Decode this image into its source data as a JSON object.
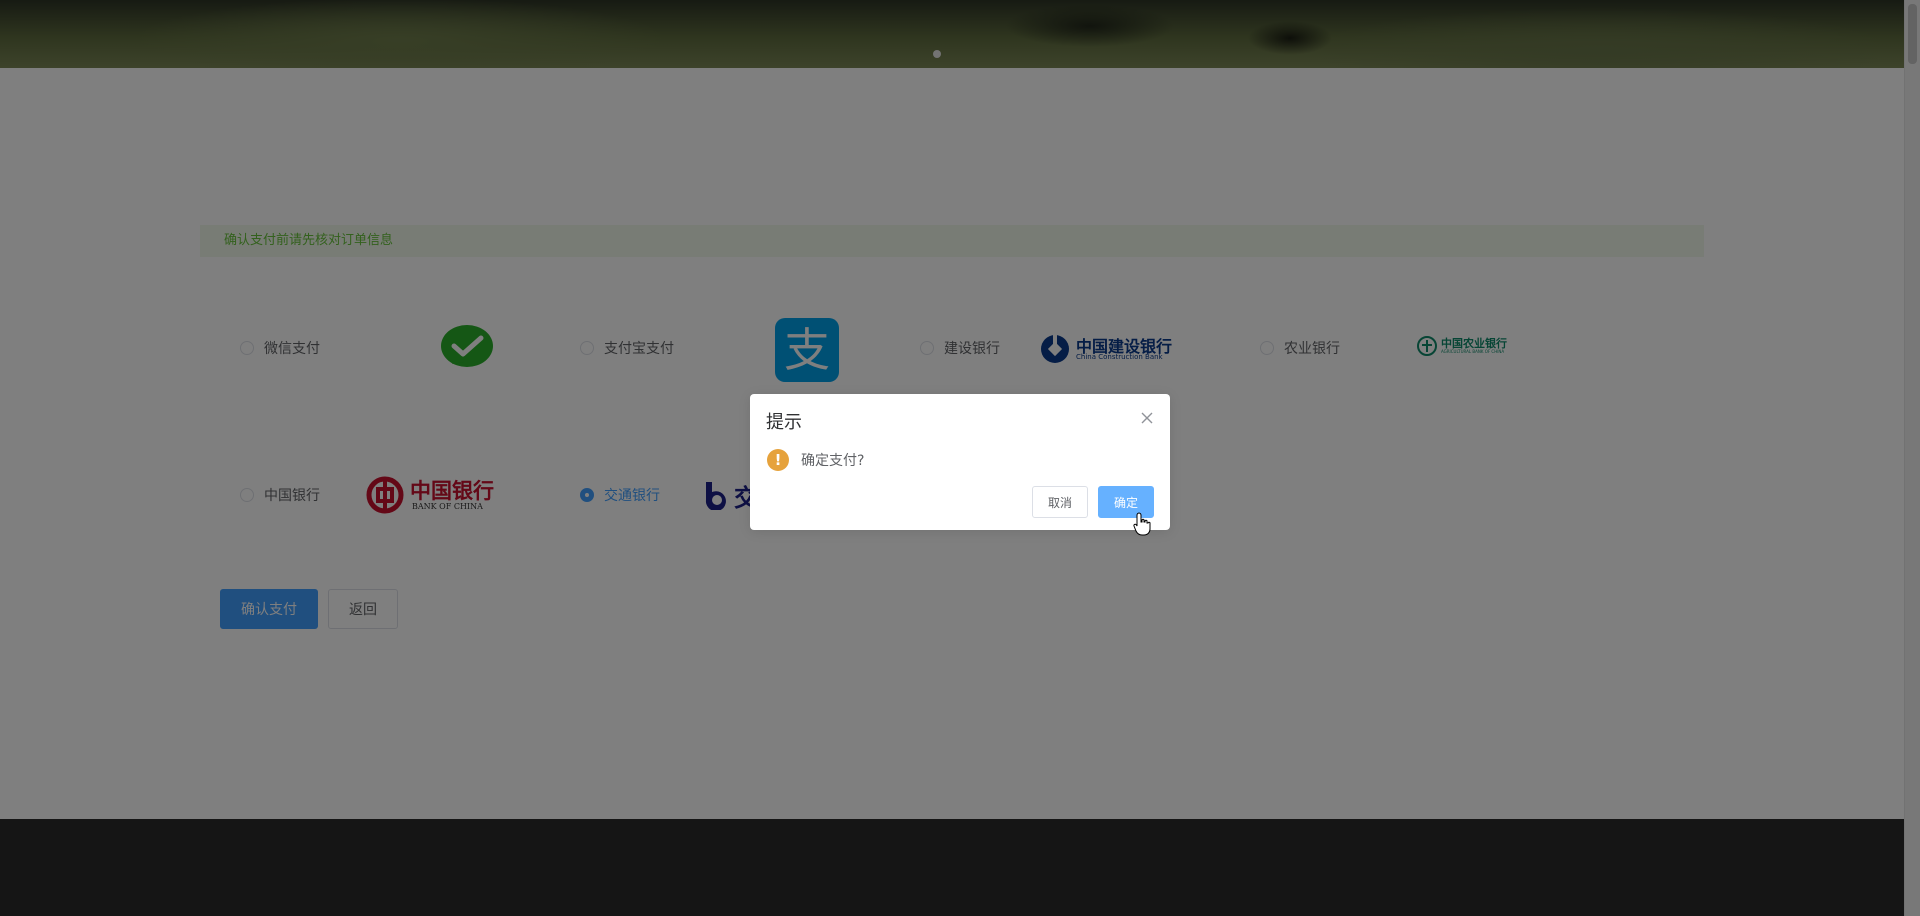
{
  "notice": {
    "text": "确认支付前请先核对订单信息"
  },
  "payment_options": [
    {
      "label": "微信支付",
      "logo": "wechat-pay-logo",
      "selected": false
    },
    {
      "label": "支付宝支付",
      "logo": "alipay-logo",
      "selected": false
    },
    {
      "label": "建设银行",
      "logo": "ccb-logo",
      "selected": false
    },
    {
      "label": "农业银行",
      "logo": "abc-logo",
      "selected": false
    },
    {
      "label": "中国银行",
      "logo": "boc-logo",
      "selected": false
    },
    {
      "label": "交通银行",
      "logo": "bocom-logo",
      "selected": true
    }
  ],
  "logos": {
    "alipay_char": "支",
    "ccb_cn": "中国建设银行",
    "ccb_en": "China Construction Bank",
    "abc_cn": "中国农业银行",
    "abc_en": "AGRICULTURAL BANK OF CHINA",
    "boc_cn": "中国银行",
    "boc_en": "BANK OF CHINA",
    "bocom_char": "交"
  },
  "actions": {
    "confirm_label": "确认支付",
    "back_label": "返回"
  },
  "dialog": {
    "title": "提示",
    "message": "确定支付?",
    "icon": "warning-icon",
    "cancel_label": "取消",
    "ok_label": "确定"
  },
  "colors": {
    "primary": "#409eff",
    "success": "#67c23a",
    "warning": "#e6a23c",
    "footer": "#2b2b2b"
  }
}
